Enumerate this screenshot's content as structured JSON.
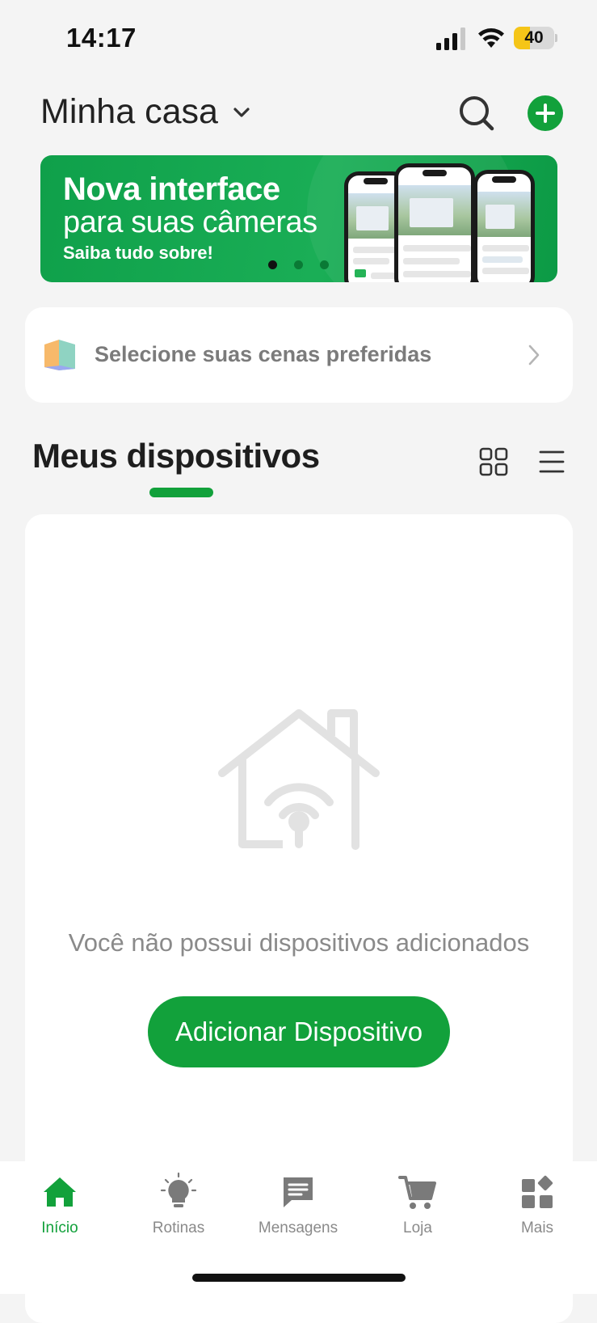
{
  "status_bar": {
    "time": "14:17",
    "battery_level": "40",
    "battery_percent": 40,
    "battery_color": "#f5c518",
    "icons": [
      "signal-icon",
      "wifi-icon",
      "battery-icon"
    ]
  },
  "header": {
    "home_name": "Minha casa",
    "icons": [
      "chevron-down-icon",
      "search-icon",
      "add-icon"
    ],
    "accent_color": "#12a13b"
  },
  "banner": {
    "line1": "Nova interface",
    "line2": "para suas câmeras",
    "line3": "Saiba tudo sobre!",
    "pages": 3,
    "active_page": 1
  },
  "scenes": {
    "label": "Selecione suas cenas preferidas"
  },
  "devices": {
    "title": "Meus dispositivos",
    "view_modes": [
      "grid-view-icon",
      "list-view-icon"
    ],
    "empty_message": "Você não possui dispositivos adicionados",
    "add_button": "Adicionar Dispositivo"
  },
  "bottom_nav": {
    "items": [
      {
        "label": "Início",
        "icon": "home-icon",
        "active": true
      },
      {
        "label": "Rotinas",
        "icon": "lightbulb-icon",
        "active": false
      },
      {
        "label": "Mensagens",
        "icon": "message-icon",
        "active": false
      },
      {
        "label": "Loja",
        "icon": "cart-icon",
        "active": false
      },
      {
        "label": "Mais",
        "icon": "apps-icon",
        "active": false
      }
    ]
  }
}
